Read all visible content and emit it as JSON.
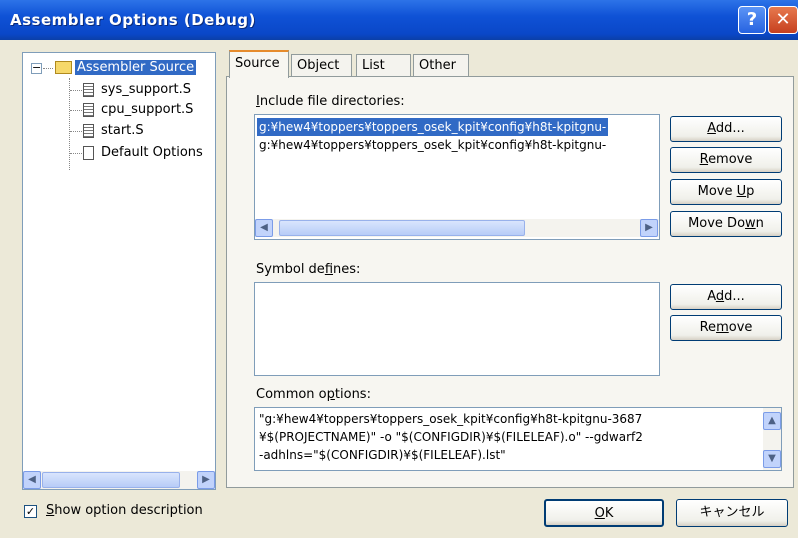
{
  "window": {
    "title": "Assembler Options (Debug)",
    "help_glyph": "?",
    "close_glyph": "✕"
  },
  "tree": {
    "root": {
      "label": "Assembler Source",
      "expander": "−"
    },
    "items": [
      {
        "label": "sys_support.S"
      },
      {
        "label": "cpu_support.S"
      },
      {
        "label": "start.S"
      },
      {
        "label": "Default Options"
      }
    ]
  },
  "tabs": [
    {
      "label": "Source",
      "active": true
    },
    {
      "label": "Object"
    },
    {
      "label": "List"
    },
    {
      "label": "Other"
    }
  ],
  "include": {
    "label_pre": "",
    "label_key": "I",
    "label_post": "nclude file directories:",
    "items": [
      "g:¥hew4¥toppers¥toppers_osek_kpit¥config¥h8t-kpitgnu-",
      "g:¥hew4¥toppers¥toppers_osek_kpit¥config¥h8t-kpitgnu-"
    ],
    "buttons": {
      "add": {
        "pre": "",
        "key": "A",
        "post": "dd..."
      },
      "remove": {
        "pre": "",
        "key": "R",
        "post": "emove"
      },
      "move_up": {
        "pre": "Move ",
        "key": "U",
        "post": "p"
      },
      "move_down": {
        "pre": "Move Do",
        "key": "w",
        "post": "n"
      }
    }
  },
  "symbols": {
    "label_pre": "Symbol de",
    "label_key": "f",
    "label_post": "ines:",
    "buttons": {
      "add": {
        "pre": "A",
        "key": "d",
        "post": "d..."
      },
      "remove": {
        "pre": "Re",
        "key": "m",
        "post": "ove"
      }
    }
  },
  "common": {
    "label_pre": "Common o",
    "label_key": "p",
    "label_post": "tions:",
    "lines": [
      "\"g:¥hew4¥toppers¥toppers_osek_kpit¥config¥h8t-kpitgnu-3687",
      "¥$(PROJECTNAME)\" -o \"$(CONFIGDIR)¥$(FILELEAF).o\" --gdwarf2",
      "-adhlns=\"$(CONFIGDIR)¥$(FILELEAF).lst\""
    ]
  },
  "footer": {
    "show_desc": {
      "key": "S",
      "post": "how option description",
      "checked": true,
      "mark": "✓"
    },
    "ok": {
      "key": "O",
      "post": "K"
    },
    "cancel": "キャンセル"
  },
  "glyphs": {
    "left": "◀",
    "right": "▶",
    "up": "▲",
    "down": "▼"
  }
}
